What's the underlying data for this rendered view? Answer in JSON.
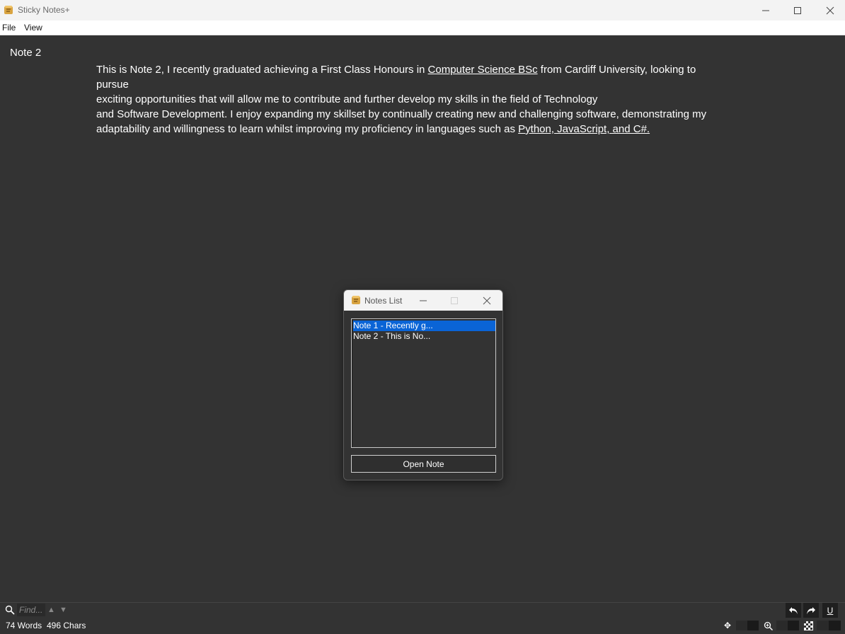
{
  "window": {
    "title": "Sticky Notes+",
    "icon": "notes-app-icon"
  },
  "menu": {
    "file": "File",
    "view": "View"
  },
  "note": {
    "title": "Note 2",
    "lines": [
      {
        "pre": "This is Note 2, I recently graduated achieving a First Class Honours in ",
        "link": "Computer Science BSc",
        "post": " from Cardiff University, looking to"
      },
      {
        "text": "pursue"
      },
      {
        "text": "exciting opportunities that will allow me to contribute and further develop my skills in the field of Technology"
      },
      {
        "text": "and Software Development. I enjoy expanding my skillset by continually creating new and challenging software, demonstrating my"
      },
      {
        "pre": "adaptability and willingness to learn whilst improving my proficiency in languages such as ",
        "link": "Python, JavaScript, and C#."
      }
    ]
  },
  "notes_list_dialog": {
    "title": "Notes List",
    "items": [
      {
        "label": "Note 1 - Recently g...",
        "selected": true
      },
      {
        "label": "Note 2 - This is No...",
        "selected": false
      }
    ],
    "open_button": "Open Note"
  },
  "find": {
    "placeholder": "Find..."
  },
  "status": {
    "words": "74 Words",
    "chars": "496 Chars"
  },
  "colors": {
    "background": "#333333",
    "selection": "#0a64d6",
    "text": "#ffffff"
  }
}
